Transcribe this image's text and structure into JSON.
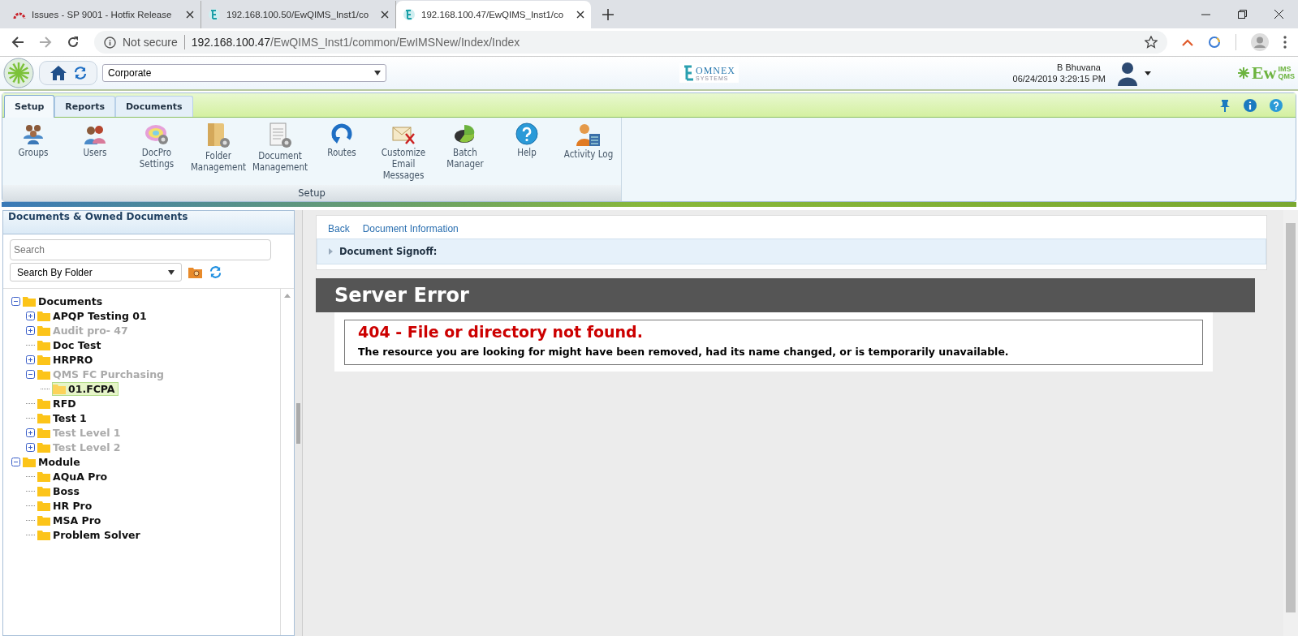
{
  "browser": {
    "tabs": [
      {
        "title": "Issues - SP 9001 - Hotfix Release",
        "selected": false,
        "kind": "arc"
      },
      {
        "title": "192.168.100.50/EwQIMS_Inst1/co",
        "selected": false,
        "kind": "app"
      },
      {
        "title": "192.168.100.47/EwQIMS_Inst1/co",
        "selected": true,
        "kind": "app"
      }
    ],
    "address": {
      "security": "Not secure",
      "host": "192.168.100.47",
      "path": "/EwQIMS_Inst1/common/EwIMSNew/Index/Index"
    }
  },
  "header": {
    "site_select": "Corporate",
    "omnex_logo": {
      "name": "OMNEX",
      "tagline": "SYSTEMS"
    },
    "user": {
      "name": "B Bhuvana",
      "datetime": "06/24/2019 3:29:15 PM"
    },
    "product_logo": {
      "main": "Ew",
      "top": "IMS",
      "bottom": "QMS"
    }
  },
  "ribbon": {
    "tabs": [
      {
        "label": "Setup",
        "selected": true
      },
      {
        "label": "Reports",
        "selected": false
      },
      {
        "label": "Documents",
        "selected": false
      }
    ],
    "items": [
      {
        "kind": "groups",
        "lines": [
          "Groups"
        ]
      },
      {
        "kind": "users",
        "lines": [
          "Users"
        ]
      },
      {
        "kind": "docpro",
        "lines": [
          "DocPro",
          "Settings"
        ]
      },
      {
        "kind": "folder",
        "lines": [
          "Folder",
          "Management"
        ]
      },
      {
        "kind": "document",
        "lines": [
          "Document",
          "Management"
        ]
      },
      {
        "kind": "routes",
        "lines": [
          "Routes"
        ]
      },
      {
        "kind": "email",
        "lines": [
          "Customize",
          "Email",
          "Messages"
        ]
      },
      {
        "kind": "batch",
        "lines": [
          "Batch",
          "Manager"
        ]
      },
      {
        "kind": "help",
        "lines": [
          "Help"
        ]
      },
      {
        "kind": "activity",
        "lines": [
          "Activity Log"
        ]
      }
    ],
    "group_label": "Setup"
  },
  "sidebar": {
    "title": "Documents & Owned Documents",
    "search": {
      "placeholder": "Search"
    },
    "filter": "Search By Folder",
    "tree": [
      {
        "label": "Documents",
        "expanded": true,
        "disabled": false,
        "selected": false,
        "children": [
          {
            "label": "APQP Testing 01",
            "expanded": false,
            "disabled": false,
            "selected": false
          },
          {
            "label": "Audit pro- 47",
            "expanded": false,
            "disabled": true,
            "selected": false
          },
          {
            "label": "Doc Test",
            "disabled": false,
            "selected": false
          },
          {
            "label": "HRPRO",
            "expanded": false,
            "disabled": false,
            "selected": false
          },
          {
            "label": "QMS FC Purchasing",
            "expanded": true,
            "disabled": true,
            "selected": false,
            "children": [
              {
                "label": "01.FCPA",
                "disabled": false,
                "selected": true
              }
            ]
          },
          {
            "label": "RFD",
            "disabled": false,
            "selected": false
          },
          {
            "label": "Test 1",
            "disabled": false,
            "selected": false
          },
          {
            "label": "Test Level 1",
            "expanded": false,
            "disabled": true,
            "selected": false
          },
          {
            "label": "Test Level 2",
            "expanded": false,
            "disabled": true,
            "selected": false
          }
        ]
      },
      {
        "label": "Module",
        "expanded": true,
        "disabled": false,
        "selected": false,
        "children": [
          {
            "label": "AQuA Pro",
            "disabled": false,
            "selected": false
          },
          {
            "label": "Boss",
            "disabled": false,
            "selected": false
          },
          {
            "label": "HR Pro",
            "disabled": false,
            "selected": false
          },
          {
            "label": "MSA Pro",
            "disabled": false,
            "selected": false
          },
          {
            "label": "Problem Solver",
            "disabled": false,
            "selected": false
          }
        ]
      }
    ]
  },
  "content": {
    "links": [
      "Back",
      "Document Information"
    ],
    "section": {
      "title": "Document Signoff:",
      "expanded": false
    },
    "error": {
      "title": "Server Error",
      "heading": "404 - File or directory not found.",
      "message": "The resource you are looking for might have been removed, had its name changed, or is temporarily unavailable."
    }
  }
}
